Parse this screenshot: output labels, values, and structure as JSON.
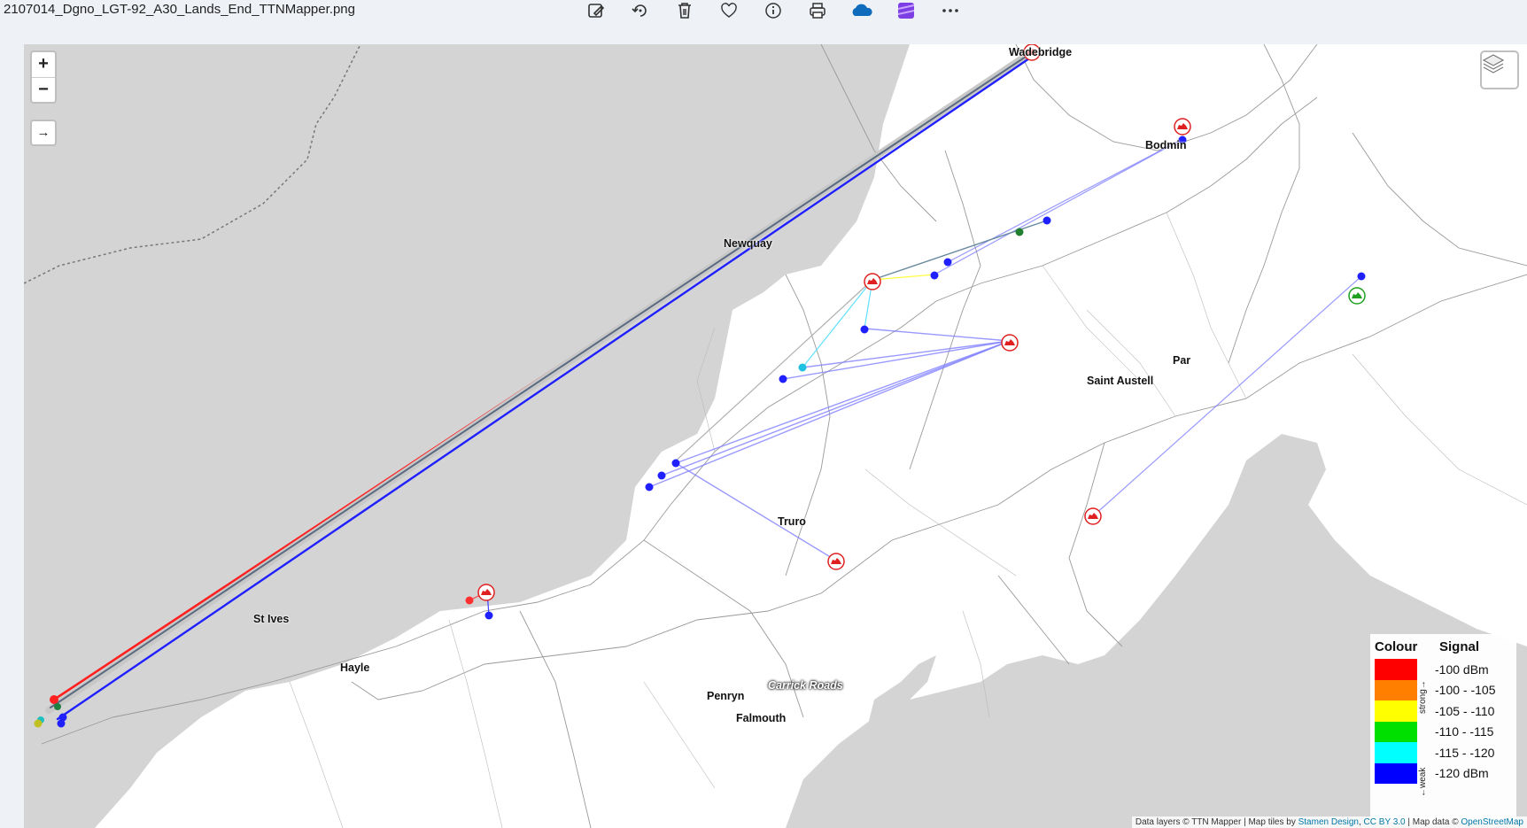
{
  "window": {
    "filename": "2107014_Dgno_LGT-92_A30_Lands_End_TTNMapper.png",
    "toolbar": [
      {
        "name": "edit-image-icon"
      },
      {
        "name": "rotate-icon"
      },
      {
        "name": "delete-icon"
      },
      {
        "name": "favorite-icon"
      },
      {
        "name": "info-icon"
      },
      {
        "name": "print-icon"
      },
      {
        "name": "onedrive-icon",
        "color": "#0f6cbd"
      },
      {
        "name": "clipchamp-icon",
        "color": "#7b3fe4"
      },
      {
        "name": "more-icon"
      }
    ]
  },
  "map": {
    "controls": {
      "zoom_in": "+",
      "zoom_out": "−",
      "expand": "→"
    },
    "places": [
      {
        "name": "Wadebridge",
        "label": "Wadebridge"
      },
      {
        "name": "Bodmin",
        "label": "Bodmin"
      },
      {
        "name": "Newquay",
        "label": "Newquay"
      },
      {
        "name": "Par",
        "label": "Par"
      },
      {
        "name": "Saint Austell",
        "label": "Saint Austell"
      },
      {
        "name": "Truro",
        "label": "Truro"
      },
      {
        "name": "St Ives",
        "label": "St Ives"
      },
      {
        "name": "Hayle",
        "label": "Hayle"
      },
      {
        "name": "Penryn",
        "label": "Penryn"
      },
      {
        "name": "Falmouth",
        "label": "Falmouth"
      },
      {
        "name": "Carrick Roads",
        "label": "Carrick Roads"
      }
    ],
    "legend": {
      "col_colour": "Colour",
      "col_signal": "Signal",
      "strong_label": "strong→",
      "weak_label": "←weak",
      "rows": [
        {
          "color": "#ff0000",
          "label": "-100 dBm"
        },
        {
          "color": "#ff8000",
          "label": "-100 - -105"
        },
        {
          "color": "#ffff00",
          "label": "-105 - -110"
        },
        {
          "color": "#00e000",
          "label": "-110 - -115"
        },
        {
          "color": "#00ffff",
          "label": "-115 - -120"
        },
        {
          "color": "#0000ff",
          "label": "-120 dBm"
        }
      ]
    },
    "attribution": {
      "prefix": "Data layers © TTN Mapper | Map tiles by",
      "link1": "Stamen Design",
      "sep1": ",",
      "link2": "CC BY 3.0",
      "mid": "| Map data ©",
      "link3": "OpenStreetMap"
    },
    "colors": {
      "sea": "#d4d4d4",
      "land": "#ffffff",
      "gateway_marker": "#e02020",
      "gateway_marker_online": "#20a020"
    }
  }
}
